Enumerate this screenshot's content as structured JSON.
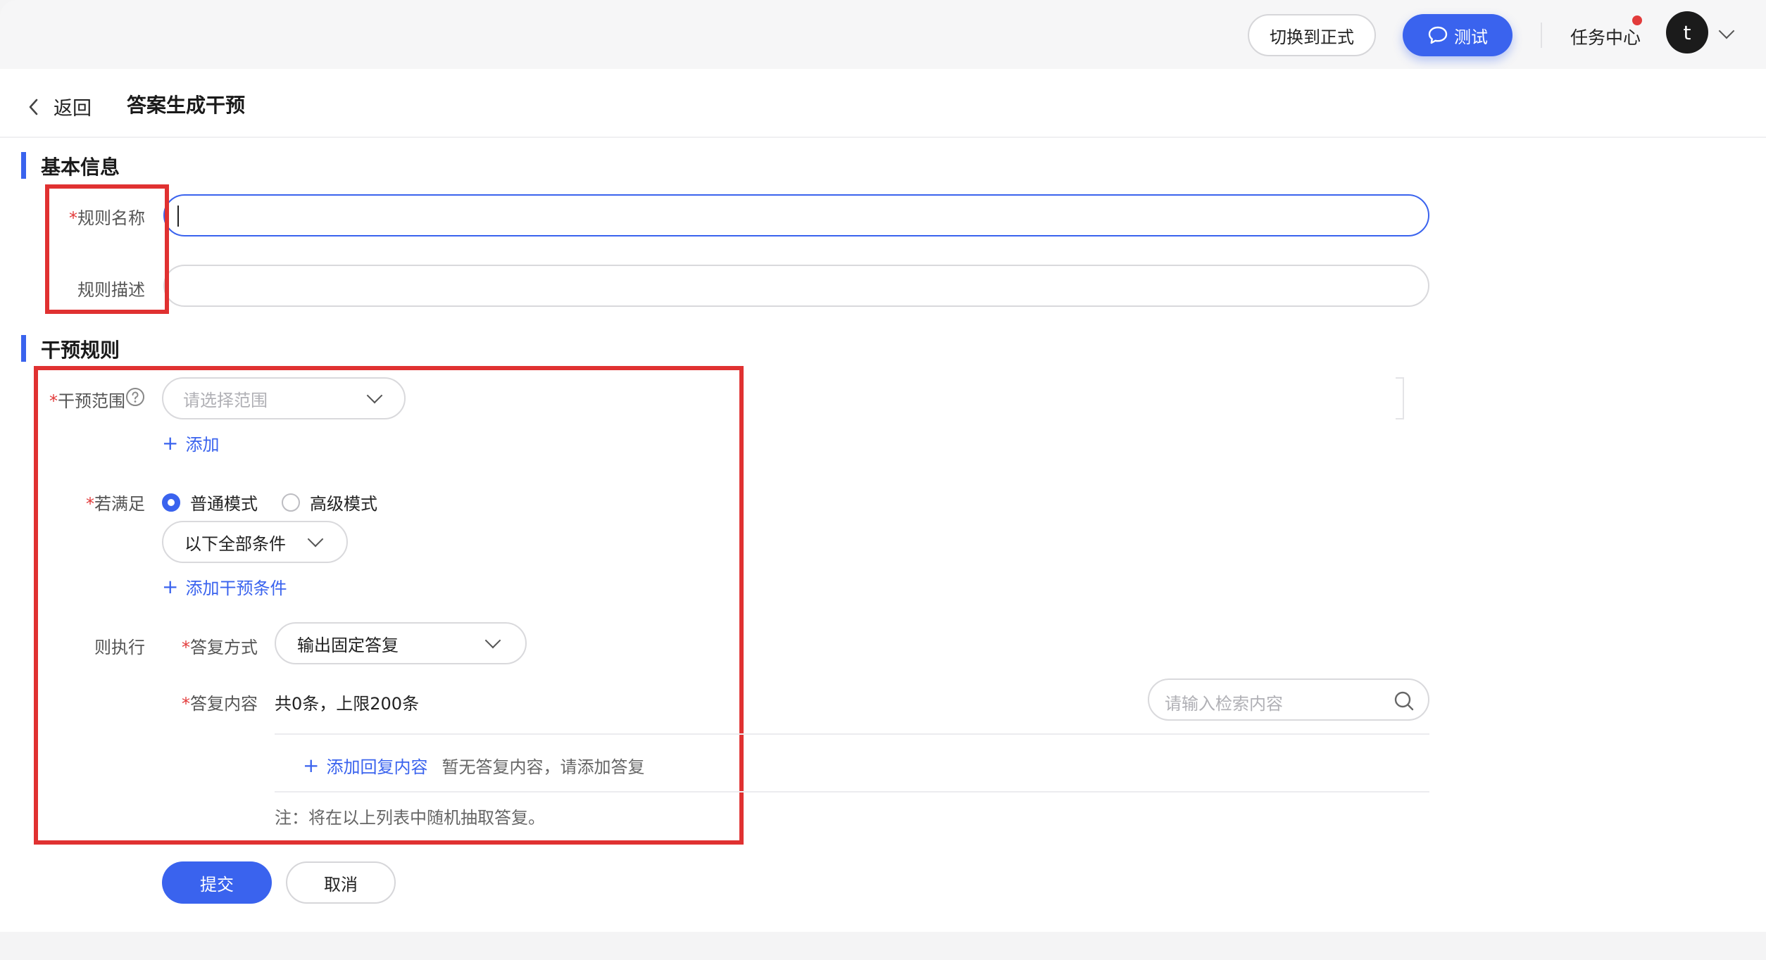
{
  "topbar": {
    "switch_label": "切换到正式",
    "test_label": "测试",
    "task_center_label": "任务中心",
    "avatar_letter": "t"
  },
  "header": {
    "back_label": "返回",
    "title": "答案生成干预"
  },
  "basic_info": {
    "section_title": "基本信息",
    "rule_name_label": "规则名称",
    "rule_name_value": "",
    "rule_desc_label": "规则描述",
    "rule_desc_value": ""
  },
  "intervention": {
    "section_title": "干预规则",
    "scope_label": "干预范围",
    "scope_placeholder": "请选择范围",
    "add_label": "添加",
    "condition_label": "若满足",
    "mode_normal": "普通模式",
    "mode_advanced": "高级模式",
    "selected_mode": "普通模式",
    "condition_select_value": "以下全部条件",
    "add_condition_label": "添加干预条件",
    "execute_label": "则执行",
    "reply_method_label": "答复方式",
    "reply_method_value": "输出固定答复",
    "reply_content_label": "答复内容",
    "reply_count_text": "共0条，上限200条",
    "search_placeholder": "请输入检索内容",
    "add_reply_label": "添加回复内容",
    "empty_reply_text": "暂无答复内容，请添加答复",
    "note_text": "注：将在以上列表中随机抽取答复。"
  },
  "actions": {
    "submit_label": "提交",
    "cancel_label": "取消"
  },
  "colors": {
    "accent": "#3a63ee",
    "required": "#e23b3b",
    "highlight_box": "#e03131"
  },
  "required_mark": "*"
}
